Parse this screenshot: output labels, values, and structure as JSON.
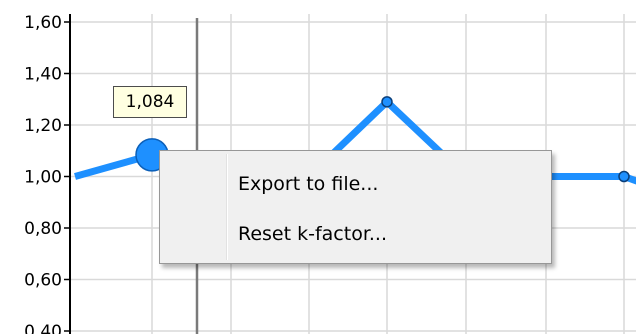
{
  "chart_data": {
    "type": "line",
    "yticks": [
      "1,60",
      "1,40",
      "1,20",
      "1,00",
      "0,80",
      "0,60",
      "0,40"
    ],
    "ylim": [
      0.4,
      1.6
    ],
    "x": [
      0,
      1,
      2,
      3,
      4,
      5,
      6,
      7,
      8
    ],
    "values": [
      1.0,
      1.084,
      1.0,
      1.0,
      1.29,
      1.0,
      1.0,
      1.0,
      0.95
    ],
    "highlighted_point": {
      "index": 1,
      "value": 1.084,
      "label": "1,084"
    },
    "grid": true,
    "series_color": "#1e90ff"
  },
  "tooltip": {
    "text": "1,084"
  },
  "context_menu": {
    "items": [
      {
        "label": "Export to file..."
      },
      {
        "label": "Reset k-factor..."
      }
    ]
  }
}
